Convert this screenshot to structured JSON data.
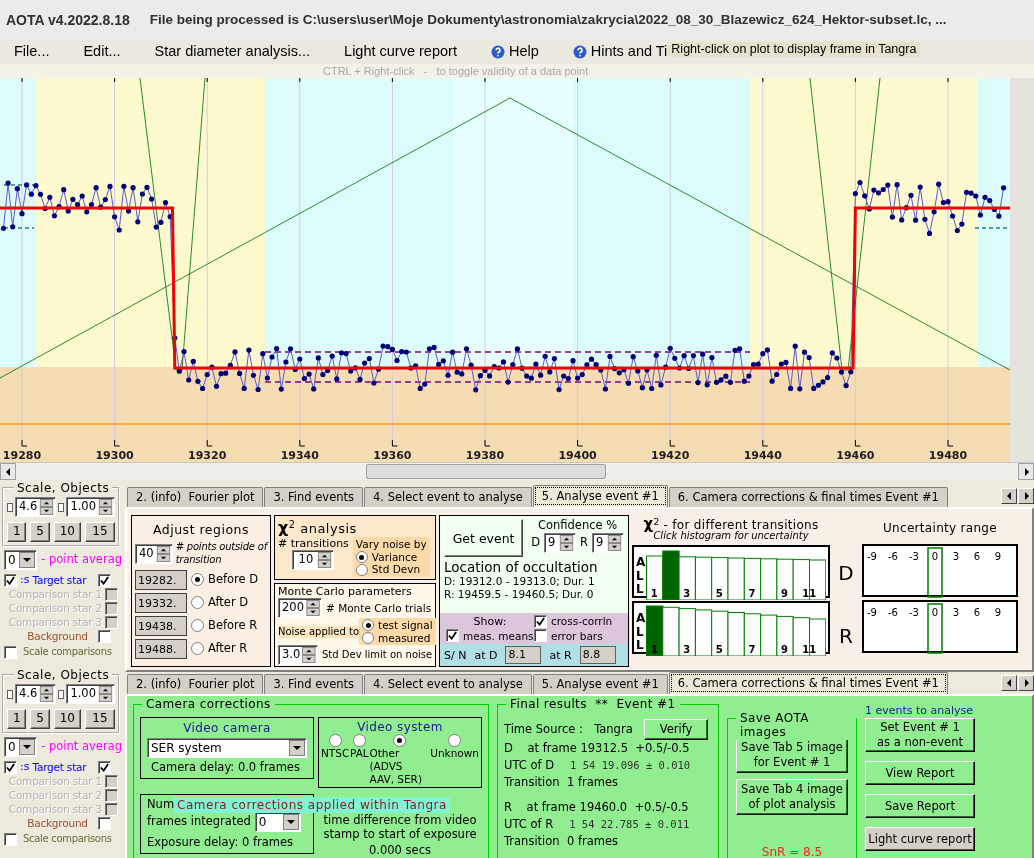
{
  "window": {
    "title": "AOTA v4.2022.8.18",
    "caption": "File being processed is C:\\users\\user\\Moje Dokumenty\\astronomia\\zakrycia\\2022_08_30_Blazewicz_624_Hektor-subset.lc, ..."
  },
  "menu": [
    {
      "label": "File...",
      "kind": "plain"
    },
    {
      "label": "Edit...",
      "kind": "plain"
    },
    {
      "label": "Star diameter analysis...",
      "kind": "plain"
    },
    {
      "label": "Light curve report",
      "kind": "plain"
    },
    {
      "label": "Help",
      "kind": "help"
    },
    {
      "label": "Hints and Ti",
      "kind": "help"
    }
  ],
  "menu_tooltip": "Right-click on plot to display frame in Tangra",
  "plot": {
    "hint": "CTRL + Right-click   -   to toggle validity of a data point",
    "x_labels": [
      "19280",
      "19300",
      "19320",
      "19340",
      "19360",
      "19380",
      "19400",
      "19420",
      "19440",
      "19460",
      "19480"
    ]
  },
  "panels": [
    {
      "kind": "analyse",
      "sidebar": {
        "title": "Scale, Objects",
        "spins": [
          {
            "value": "4.6",
            "checked": false
          },
          {
            "value": "1.00",
            "checked": false
          }
        ],
        "buttons": [
          "1",
          "5",
          "10",
          "15"
        ],
        "average": {
          "value": "0",
          "label": "- point averag"
        },
        "master": {
          "label": ":s",
          "checked": true
        },
        "objects": [
          {
            "label": "Target star",
            "checked": true,
            "enabled": true,
            "color": "#0000ff"
          },
          {
            "label": "Comparison star 1",
            "checked": false,
            "enabled": false,
            "color": "#b4b4b4"
          },
          {
            "label": "Comparison star 2",
            "checked": false,
            "enabled": false,
            "color": "#b4b4b4"
          },
          {
            "label": "Comparison star 3",
            "checked": false,
            "enabled": false,
            "color": "#b4b4b4"
          },
          {
            "label": "Background",
            "checked": false,
            "enabled": true,
            "color": "#a0522d"
          }
        ],
        "scale_comparisons": {
          "label": "Scale comparisons",
          "checked": false
        }
      },
      "tabs": [
        {
          "label": "2. (info)  Fourier plot",
          "selected": false
        },
        {
          "label": "3. Find events",
          "selected": false
        },
        {
          "label": "4. Select event to analyse",
          "selected": false
        },
        {
          "label": "5. Analyse event #1",
          "selected": true
        },
        {
          "label": "6. Camera corrections & final times Event #1",
          "selected": false
        }
      ],
      "adjust": {
        "title": "Adjust regions",
        "points": "40",
        "points_label": "# points outside of transition",
        "regions": [
          {
            "value": "19282.",
            "label": "Before D",
            "selected": true
          },
          {
            "value": "19332.",
            "label": "After D",
            "selected": false
          },
          {
            "value": "19438.",
            "label": "Before R",
            "selected": false
          },
          {
            "value": "19488.",
            "label": "After R",
            "selected": false
          }
        ]
      },
      "chi": {
        "title": "χ$^{2}$ analysis",
        "transitions_label": "# transitions",
        "transitions": "10",
        "noise_title": "Vary noise by",
        "noise": [
          {
            "label": "Variance",
            "selected": true
          },
          {
            "label": "Std Devn",
            "selected": false
          }
        ]
      },
      "monte_carlo": {
        "title": "Monte Carlo parameters",
        "trials": "200",
        "trials_label": "# Monte Carlo trials",
        "noise_label": "Noise applied to",
        "apply": [
          {
            "label": "test signal",
            "selected": true
          },
          {
            "label": "measured",
            "selected": false
          }
        ],
        "limit": "3.0",
        "limit_label": "Std Dev limit on noise"
      },
      "event": {
        "button": "Get event",
        "confidence_title": "Confidence %",
        "confidence": [
          {
            "label": "D",
            "value": "9"
          },
          {
            "label": "R",
            "value": "9"
          }
        ],
        "location_title": "Location of occultation",
        "location": [
          "D: 19312.0 - 19313.0; Dur. 1",
          "R: 19459.5 - 19460.5; Dur. 0"
        ],
        "show_title": "Show:",
        "show": [
          {
            "label": "cross-corrln",
            "checked": true
          },
          {
            "label": "meas. means",
            "checked": true
          },
          {
            "label": "error bars",
            "checked": false
          }
        ],
        "sn_label": "S/ N",
        "sn": [
          {
            "label": "at D",
            "value": "8.1"
          },
          {
            "label": "at R",
            "value": "8.8"
          }
        ]
      },
      "histograms": {
        "title": "χ$^{2}$ -  for different transitions",
        "subtitle": "Click histogram for uncertainty",
        "rows": [
          {
            "side": "D",
            "all_label": "ALL",
            "ticks": [
              "1",
              "3",
              "5",
              "7",
              "9",
              "11"
            ],
            "bars": [
              {
                "selected": false
              },
              {
                "selected": true
              },
              {
                "selected": false
              },
              {
                "selected": false
              },
              {
                "selected": false
              },
              {
                "selected": false
              },
              {
                "selected": false
              },
              {
                "selected": false
              },
              {
                "selected": false
              },
              {
                "selected": false
              },
              {
                "selected": false
              }
            ]
          },
          {
            "side": "R",
            "all_label": "ALL",
            "ticks": [
              "1",
              "3",
              "5",
              "7",
              "9",
              "11"
            ],
            "bars": [
              {
                "selected": true
              },
              {
                "selected": false
              },
              {
                "selected": false
              },
              {
                "selected": false
              },
              {
                "selected": false
              },
              {
                "selected": false
              },
              {
                "selected": false
              },
              {
                "selected": false
              },
              {
                "selected": false
              },
              {
                "selected": false
              },
              {
                "selected": false
              }
            ]
          }
        ]
      },
      "uncertainty": {
        "title": "Uncertainty range",
        "boxes": [
          {
            "ticks": [
              "-9",
              "-6",
              "-3",
              "0",
              "3",
              "6",
              "9"
            ]
          },
          {
            "ticks": [
              "-9",
              "-6",
              "-3",
              "0",
              "3",
              "6",
              "9"
            ]
          }
        ]
      }
    },
    {
      "kind": "corrections",
      "sidebar": {
        "title": "Scale, Objects",
        "spins": [
          {
            "value": "4.6",
            "checked": false
          },
          {
            "value": "1.00",
            "checked": false
          }
        ],
        "buttons": [
          "1",
          "5",
          "10",
          "15"
        ],
        "average": {
          "value": "0",
          "label": "- point averag"
        },
        "master": {
          "label": ":s",
          "checked": true
        },
        "objects": [
          {
            "label": "Target star",
            "checked": true,
            "enabled": true,
            "color": "#0000ff"
          },
          {
            "label": "Comparison star 1",
            "checked": false,
            "enabled": false,
            "color": "#b4b4b4"
          },
          {
            "label": "Comparison star 2",
            "checked": false,
            "enabled": false,
            "color": "#b4b4b4"
          },
          {
            "label": "Comparison star 3",
            "checked": false,
            "enabled": false,
            "color": "#b4b4b4"
          },
          {
            "label": "Background",
            "checked": false,
            "enabled": true,
            "color": "#a0522d"
          }
        ],
        "scale_comparisons": {
          "label": "Scale comparisons",
          "checked": false
        }
      },
      "tabs": [
        {
          "label": "2. (info)  Fourier plot",
          "selected": false
        },
        {
          "label": "3. Find events",
          "selected": false
        },
        {
          "label": "4. Select event to analyse",
          "selected": false
        },
        {
          "label": "5. Analyse event #1",
          "selected": false
        },
        {
          "label": "6. Camera corrections & final times Event #1",
          "selected": true
        }
      ],
      "camera": {
        "title": "Camera corrections",
        "video_camera": {
          "title": "Video camera",
          "value": "SER system",
          "delay": "Camera delay: 0.0 frames"
        },
        "video_system": {
          "title": "Video system",
          "options": [
            {
              "label": "NTSC",
              "selected": false
            },
            {
              "label": "PAL",
              "selected": false
            },
            {
              "label": "Other (ADVS AAV, SER)",
              "selected": true
            },
            {
              "label": "Unknown",
              "selected": false
            }
          ]
        },
        "integration": {
          "label": "Num",
          "label2": "frames integrated",
          "value": "0",
          "delay": "Exposure delay:  0 frames"
        },
        "time_diff": {
          "label": "time difference from video stamp to start of exposure",
          "value": "0.000 secs"
        },
        "tooltip": "Camera corrections applied within Tangra"
      },
      "final": {
        "title": "Final results  **  Event #1",
        "time_source_label": "Time Source :",
        "time_source": "Tangra",
        "verify": "Verify",
        "events": [
          {
            "frame": "D    at frame 19312.5  +0.5/-0.5",
            "utc_label": "UTC of D",
            "utc": "1 54 19.096 ± 0.010",
            "transition": "Transition  1 frames"
          },
          {
            "frame": "R    at frame 19460.0  +0.5/-0.5",
            "utc_label": "UTC of R",
            "utc": "1 54 22.785 ± 0.011",
            "transition": "Transition  0 frames"
          }
        ]
      },
      "save": {
        "title": "Save AOTA images",
        "buttons": [
          "Save Tab 5 image for Event # 1",
          "Save Tab 4 image of plot analysis"
        ],
        "snr": "SnR = 8.5"
      },
      "actions": {
        "count": "1 events to analyse",
        "buttons": [
          {
            "label": "Set Event # 1 as a non-event",
            "kind": "green"
          },
          {
            "label": "View Report",
            "kind": "green"
          },
          {
            "label": "Save Report",
            "kind": "green"
          },
          {
            "label": "Light curve report",
            "kind": "grey"
          }
        ]
      }
    }
  ]
}
